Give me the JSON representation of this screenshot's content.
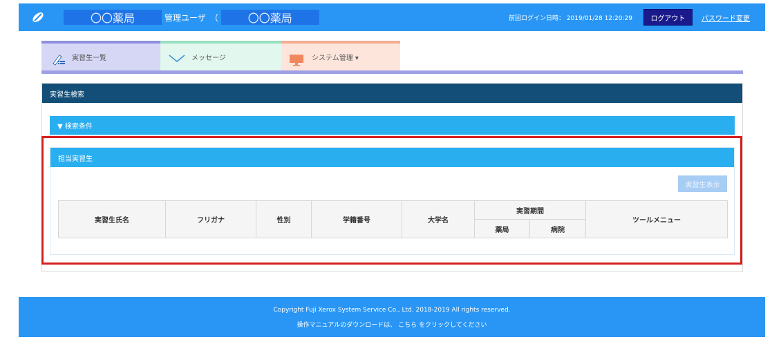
{
  "header": {
    "pharmacy_name": "〇〇薬局",
    "user_label": "管理ユーザ",
    "user_open_paren": "（",
    "user_pharmacy": "〇〇薬局",
    "last_login": "前回ログイン日時： 2019/01/28 12:20:29",
    "logout_label": "ログアウト",
    "password_change_label": "パスワード変更"
  },
  "tabs": [
    {
      "label": "実習生一覧",
      "icon": "list-pen-icon"
    },
    {
      "label": "メッセージ",
      "icon": "envelope-icon"
    },
    {
      "label": "システム管理 ▾",
      "icon": "monitor-icon"
    }
  ],
  "panel": {
    "title": "実習生検索",
    "search_conditions_label": "▼ 検索条件",
    "assigned_title": "担当実習生",
    "show_trainee_button": "実習生表示"
  },
  "table": {
    "headers": {
      "name": "実習生氏名",
      "furigana": "フリガナ",
      "gender": "性別",
      "student_id": "学籍番号",
      "university": "大学名",
      "period": "実習期間",
      "pharmacy": "薬局",
      "hospital": "病院",
      "tools": "ツールメニュー"
    },
    "rows": []
  },
  "footer": {
    "copyright": "Copyright Fuji Xerox System Service Co., Ltd. 2018-2019 All rights reserved.",
    "manual": "操作マニュアルのダウンロードは、 こちら をクリックしてください"
  },
  "colors": {
    "header_bg": "#2996f5",
    "panel_head_bg": "#124e77",
    "section_bg": "#29aef0",
    "highlight_border": "#d41f1f"
  }
}
